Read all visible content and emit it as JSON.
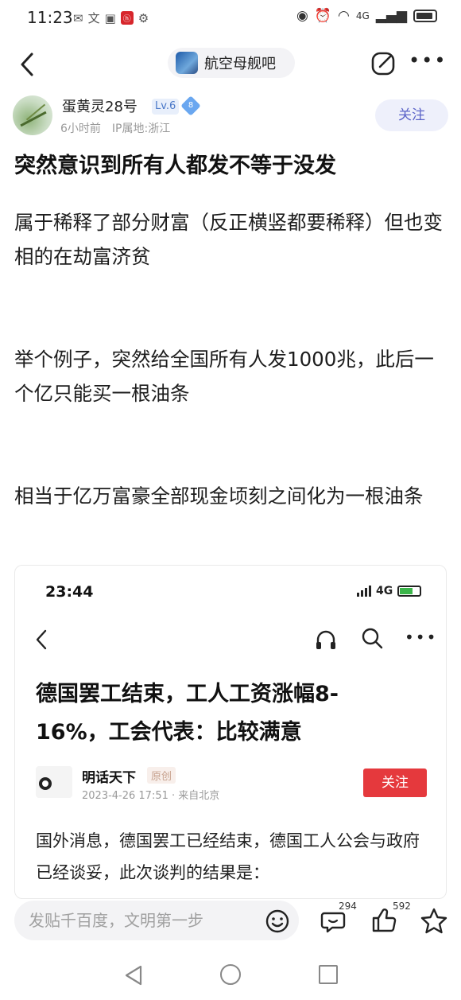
{
  "status_bar": {
    "time": "11:23",
    "network": "4G"
  },
  "nav": {
    "forum_name": "航空母舰吧"
  },
  "author": {
    "name": "蛋黄灵28号",
    "level": "Lv.6",
    "vip": "8",
    "time_ago": "6小时前",
    "ip": "IP属地:浙江",
    "follow_label": "关注"
  },
  "post": {
    "title": "突然意识到所有人都发不等于没发",
    "paragraphs": [
      "属于稀释了部分财富（反正横竖都要稀释）但也变相的在劫富济贫",
      "举个例子，突然给全国所有人发1000兆，此后一个亿只能买一根油条",
      "相当于亿万富豪全部现金顷刻之间化为一根油条"
    ]
  },
  "embed": {
    "time": "23:44",
    "network": "4G",
    "title": "德国罢工结束，工人工资涨幅8-16%，工会代表：比较满意",
    "author": "明话天下",
    "badge": "原创",
    "date": "2023-4-26 17:51 · 来自北京",
    "follow_label": "关注",
    "body": "国外消息，德国罢工已经结束，德国工人公会与政府已经谈妥，此次谈判的结果是："
  },
  "bottom_bar": {
    "placeholder": "发贴千百度，文明第一步",
    "comment_count": "294",
    "like_count": "592"
  },
  "colors": {
    "follow_text": "#5b63c8",
    "embed_follow_bg": "#e5393d"
  }
}
